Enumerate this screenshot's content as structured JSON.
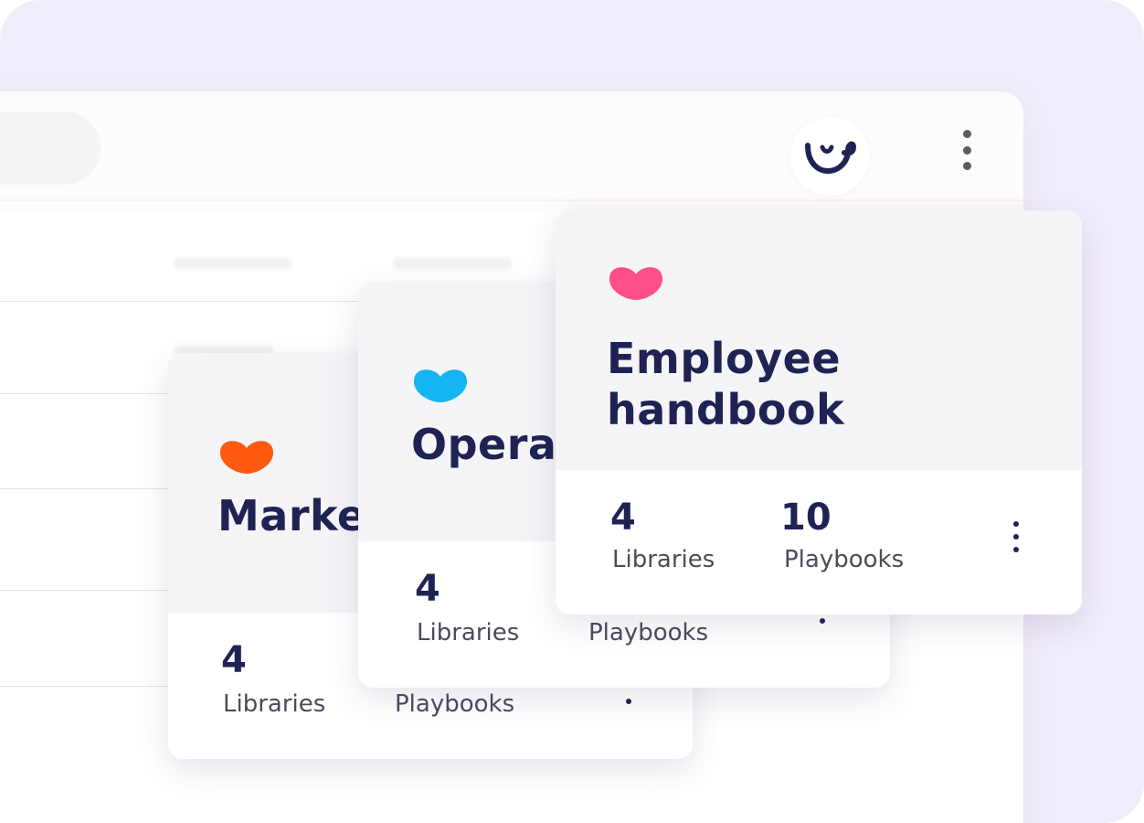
{
  "icons": {
    "avatar": "smiley-logo-icon",
    "more": "vertical-dots-icon",
    "card_brand": "heart-icon"
  },
  "colors": {
    "background": "#f1edfb",
    "title": "#1f2354",
    "heart_marketing": "#ff5a0f",
    "heart_operations": "#14b5f2",
    "heart_employee": "#ff4f8a"
  },
  "cards": [
    {
      "id": "marketing",
      "title": "Marke",
      "libraries_count": "4",
      "libraries_label": "Libraries",
      "playbooks_label": "Playbooks"
    },
    {
      "id": "operations",
      "title": "Opera",
      "libraries_count": "4",
      "libraries_label": "Libraries",
      "playbooks_label": "Playbooks"
    },
    {
      "id": "employee",
      "title": "Employee\nhandbook",
      "libraries_count": "4",
      "libraries_label": "Libraries",
      "playbooks_count": "10",
      "playbooks_label": "Playbooks"
    }
  ]
}
